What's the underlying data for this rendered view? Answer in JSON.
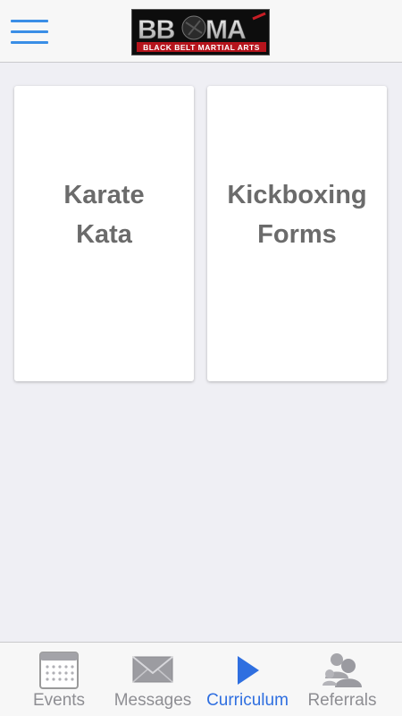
{
  "header": {
    "logo_text": "BBMA",
    "logo_subtext": "BLACK BELT MARTIAL ARTS"
  },
  "cards": [
    {
      "line1": "Karate",
      "line2": "Kata"
    },
    {
      "line1": "Kickboxing",
      "line2": "Forms"
    }
  ],
  "tabs": [
    {
      "label": "Events",
      "icon": "calendar-icon"
    },
    {
      "label": "Messages",
      "icon": "envelope-icon"
    },
    {
      "label": "Curriculum",
      "icon": "play-icon",
      "active": true
    },
    {
      "label": "Referrals",
      "icon": "people-icon"
    }
  ],
  "colors": {
    "accent": "#2f6fe0",
    "menu": "#3a8ee6",
    "background": "#efeff4",
    "card_text": "#6b6b6b",
    "tab_inactive": "#8e8e93"
  }
}
